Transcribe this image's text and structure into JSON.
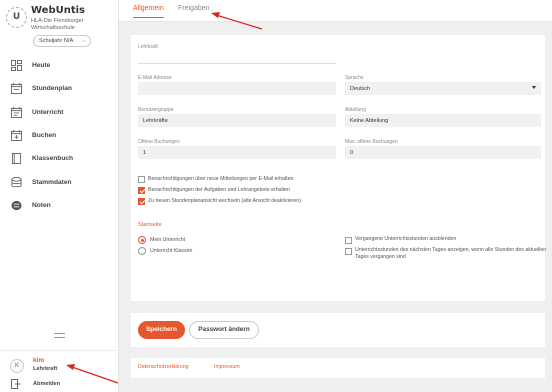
{
  "app": {
    "logo_letter": "U",
    "title": "WebUntis",
    "school_line1": "HLA-Die Flensburger",
    "school_line2": "Wirtschaftsschule",
    "year_select": "Schuljahr N/A"
  },
  "sidebar": {
    "items": [
      {
        "label": "Heute",
        "icon": "dashboard-icon"
      },
      {
        "label": "Stundenplan",
        "icon": "calendar-icon"
      },
      {
        "label": "Unterricht",
        "icon": "calendar-list-icon"
      },
      {
        "label": "Buchen",
        "icon": "calendar-plus-icon"
      },
      {
        "label": "Klassenbuch",
        "icon": "book-icon"
      },
      {
        "label": "Stammdaten",
        "icon": "database-icon"
      },
      {
        "label": "Noten",
        "icon": "grades-icon"
      }
    ],
    "user": {
      "avatar": "K",
      "name": "kim",
      "role": "Lehrkraft"
    },
    "logout_label": "Abmelden"
  },
  "tabs": [
    {
      "label": "Allgemein",
      "active": true
    },
    {
      "label": "Freigaben",
      "active": false
    }
  ],
  "form": {
    "lehrkraft": {
      "label": "Lehrkraft",
      "value": ""
    },
    "email": {
      "label": "E-Mail Adresse",
      "value": ""
    },
    "sprache": {
      "label": "Sprache",
      "value": "Deutsch"
    },
    "benutzergruppe": {
      "label": "Benutzergruppe",
      "value": "Lehrkräfte"
    },
    "abteilung": {
      "label": "Abteilung",
      "value": "Keine Abteilung"
    },
    "offene_buchungen": {
      "label": "Offene Buchungen",
      "value": "1"
    },
    "max_buchungen": {
      "label": "Max. offene Buchungen",
      "value": "0"
    },
    "checkboxes": [
      {
        "label": "Benachrichtigungen über neue Mitteilungen per E-Mail erhalten",
        "checked": false
      },
      {
        "label": "Benachrichtigungen der Aufgaben und Lehrangebote erhalten",
        "checked": true
      },
      {
        "label": "Zu neuen Stundenplanansicht wechseln (alte Ansicht deaktivieren)",
        "checked": true
      }
    ],
    "section_title": "Startseite",
    "radios": [
      {
        "label": "Mein Unterricht",
        "checked": true
      },
      {
        "label": "Unterricht Klassen",
        "checked": false
      }
    ],
    "right_checkboxes": [
      {
        "label": "Vergangene Unterrichtsstunden ausblenden",
        "checked": false
      },
      {
        "label": "Unterrichtsstunden des nächsten Tages anzeigen, wenn alle Stunden des aktuellen Tages vergangen sind",
        "checked": false
      }
    ]
  },
  "actions": {
    "save": "Speichern",
    "change_password": "Passwort ändern"
  },
  "footer": {
    "privacy": "Datenschutzerklärung",
    "imprint": "Impressum"
  },
  "colors": {
    "accent": "#e5572e",
    "annotation_arrow": "#d8281f"
  }
}
